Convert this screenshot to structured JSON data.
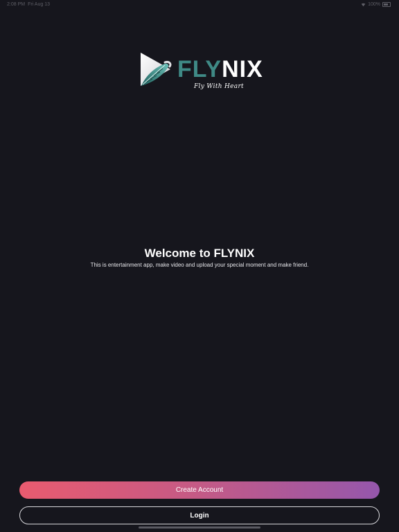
{
  "status_bar": {
    "time": "2:08 PM",
    "date": "Fri Aug 13",
    "battery": "100%",
    "icons": [
      "wifi-icon",
      "battery-icon"
    ]
  },
  "logo": {
    "brand_part1": "FLY",
    "brand_part2": "NIX",
    "tagline": "Fly With Heart"
  },
  "welcome": {
    "title": "Welcome to FLYNIX",
    "description": "This is entertainment app, make video and upload your special moment and make friend."
  },
  "buttons": {
    "create_account": "Create Account",
    "login": "Login"
  },
  "colors": {
    "background": "#16161d",
    "brand_teal": "#3f8a86",
    "gradient_start": "#e95b6f",
    "gradient_end": "#9557ac"
  }
}
